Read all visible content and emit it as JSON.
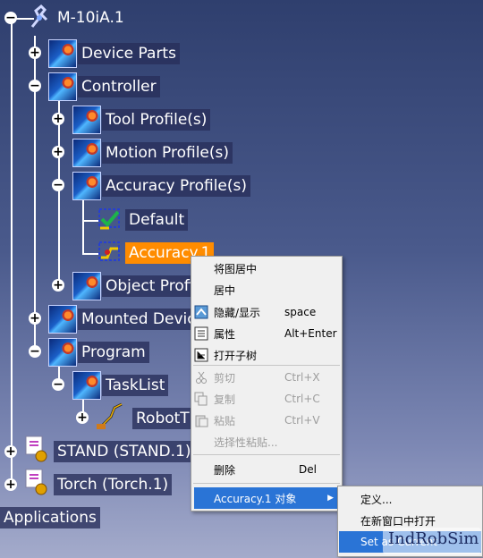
{
  "tree": {
    "root": "M-10iA.1",
    "items": [
      {
        "label": "Device Parts"
      },
      {
        "label": "Controller"
      },
      {
        "label": "Tool Profile(s)"
      },
      {
        "label": "Motion Profile(s)"
      },
      {
        "label": "Accuracy Profile(s)"
      },
      {
        "label": "Default"
      },
      {
        "label": "Accuracy.1"
      },
      {
        "label": "Object Profi"
      },
      {
        "label": "Mounted Devic"
      },
      {
        "label": "Program"
      },
      {
        "label": "TaskList"
      },
      {
        "label": "RobotT"
      },
      {
        "label": "STAND (STAND.1)"
      },
      {
        "label": "Torch (Torch.1)"
      },
      {
        "label": "Applications"
      }
    ]
  },
  "context_menu": {
    "items": [
      {
        "label": "将图居中",
        "shortcut": ""
      },
      {
        "label": "居中",
        "shortcut": ""
      },
      {
        "label": "隐藏/显示",
        "shortcut": "space"
      },
      {
        "label": "属性",
        "shortcut": "Alt+Enter"
      },
      {
        "label": "打开子树",
        "shortcut": ""
      },
      {
        "label": "剪切",
        "shortcut": "Ctrl+X"
      },
      {
        "label": "复制",
        "shortcut": "Ctrl+C"
      },
      {
        "label": "粘贴",
        "shortcut": "Ctrl+V"
      },
      {
        "label": "选择性粘贴...",
        "shortcut": ""
      },
      {
        "label": "删除",
        "shortcut": "Del"
      },
      {
        "label": "Accuracy.1 对象",
        "shortcut": ""
      }
    ]
  },
  "submenu": {
    "items": [
      {
        "label": "定义..."
      },
      {
        "label": "在新窗口中打开"
      },
      {
        "label": "Set as Current"
      }
    ]
  },
  "watermark": {
    "text": "IndRobSim"
  },
  "colors": {
    "selection": "#ff8c00",
    "menu_highlight": "#2a74d6"
  }
}
